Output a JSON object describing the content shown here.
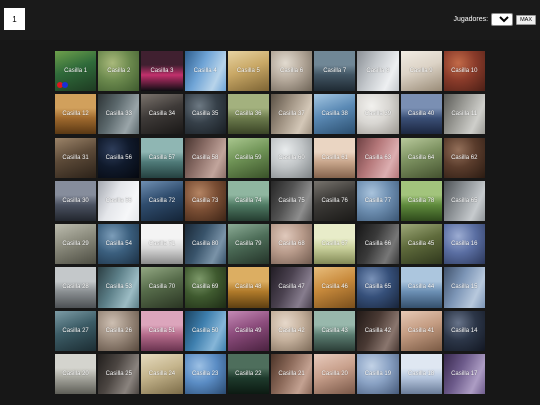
{
  "turn": "1",
  "players": {
    "label": "Jugadores:",
    "selected": "2",
    "max_label": "MAX"
  },
  "tokens": {
    "p1_color": "#e0161c",
    "p2_color": "#1a2fd6"
  },
  "board": {
    "cells": [
      {
        "label": "Casilla 1",
        "colors": [
          "#2f6a3a",
          "#6ea04c",
          "#1e3b22"
        ]
      },
      {
        "label": "Casilla 2",
        "colors": [
          "#6c8a4e",
          "#a9b97b",
          "#3e5a2e"
        ]
      },
      {
        "label": "Casilla 3",
        "colors": [
          "#c1306c",
          "#402030",
          "#0d0d12"
        ]
      },
      {
        "label": "Casilla 4",
        "colors": [
          "#6fa4d6",
          "#b8d4ea",
          "#2f5e8e"
        ]
      },
      {
        "label": "Casilla 5",
        "colors": [
          "#c9a866",
          "#e7d3a2",
          "#7d6434"
        ]
      },
      {
        "label": "Casilla 6",
        "colors": [
          "#b4a89a",
          "#e2dbd0",
          "#6e6457"
        ]
      },
      {
        "label": "Casilla 7",
        "colors": [
          "#415462",
          "#708796",
          "#1f2a33"
        ]
      },
      {
        "label": "Casilla 8",
        "colors": [
          "#c4c8cc",
          "#eef0f2",
          "#8b9096"
        ]
      },
      {
        "label": "Casilla 9",
        "colors": [
          "#dcd3c6",
          "#f1ece3",
          "#9a8c78"
        ]
      },
      {
        "label": "Casilla 10",
        "colors": [
          "#8a3b2a",
          "#c26a48",
          "#4b1f16"
        ]
      },
      {
        "label": "Casilla 12",
        "colors": [
          "#a06a2e",
          "#d1a05c",
          "#5a3814"
        ]
      },
      {
        "label": "Casilla 33",
        "colors": [
          "#5d6a6e",
          "#9aa5a9",
          "#2e3537"
        ]
      },
      {
        "label": "Casilla 34",
        "colors": [
          "#3e3a38",
          "#7b736c",
          "#1a1817"
        ]
      },
      {
        "label": "Casilla 35",
        "colors": [
          "#364049",
          "#6d7983",
          "#181d22"
        ]
      },
      {
        "label": "Casilla 36",
        "colors": [
          "#6b7a4c",
          "#a3b17e",
          "#3a4426"
        ]
      },
      {
        "label": "Casilla 37",
        "colors": [
          "#a09383",
          "#d4c8b8",
          "#5c5246"
        ]
      },
      {
        "label": "Casilla 38",
        "colors": [
          "#5b8ab5",
          "#a5c7e2",
          "#2b4f70"
        ]
      },
      {
        "label": "Casilla 39",
        "colors": [
          "#d8d6d2",
          "#f2f1ee",
          "#9c9892"
        ]
      },
      {
        "label": "Casilla 40",
        "colors": [
          "#3a4f76",
          "#7a8fb3",
          "#1c2640"
        ]
      },
      {
        "label": "Casilla 11",
        "colors": [
          "#9b9b96",
          "#cfcfcb",
          "#5b5b57"
        ]
      },
      {
        "label": "Casilla 31",
        "colors": [
          "#5c4a38",
          "#9c8469",
          "#2c2219"
        ]
      },
      {
        "label": "Casilla 56",
        "colors": [
          "#101a2c",
          "#2e3d5a",
          "#05080f"
        ]
      },
      {
        "label": "Casilla 57",
        "colors": [
          "#4f7a78",
          "#8fb6b3",
          "#254140"
        ]
      },
      {
        "label": "Casilla 58",
        "colors": [
          "#8c6f68",
          "#c2a59c",
          "#4a3631"
        ]
      },
      {
        "label": "Casilla 59",
        "colors": [
          "#6f9356",
          "#a9c68e",
          "#3a5229"
        ]
      },
      {
        "label": "Casilla 60",
        "colors": [
          "#c0c4c6",
          "#e9eced",
          "#7d8285"
        ]
      },
      {
        "label": "Casilla 61",
        "colors": [
          "#c8a68c",
          "#ead5c2",
          "#85644d"
        ]
      },
      {
        "label": "Casilla 63",
        "colors": [
          "#b5787a",
          "#dcaeb0",
          "#6f4244"
        ]
      },
      {
        "label": "Casilla 64",
        "colors": [
          "#7c9160",
          "#b9c99c",
          "#44522f"
        ]
      },
      {
        "label": "Casilla 62",
        "colors": [
          "#5a3c2c",
          "#94705a",
          "#2b1b12"
        ]
      },
      {
        "label": "Casilla 30",
        "colors": [
          "#4a5160",
          "#868d9c",
          "#22262e"
        ]
      },
      {
        "label": "Casilla 55",
        "colors": [
          "#e4e6ea",
          "#f6f7f9",
          "#a4a8b0"
        ]
      },
      {
        "label": "Casilla 72",
        "colors": [
          "#2f4c6d",
          "#6f8fb2",
          "#142437"
        ]
      },
      {
        "label": "Casilla 73",
        "colors": [
          "#7a4e34",
          "#b48463",
          "#3d2416"
        ]
      },
      {
        "label": "Casilla 74",
        "colors": [
          "#4f7a63",
          "#8fb6a0",
          "#243c30"
        ]
      },
      {
        "label": "Casilla 75",
        "colors": [
          "#525252",
          "#8e8e8e",
          "#262626"
        ]
      },
      {
        "label": "Casilla 76",
        "colors": [
          "#3c3a37",
          "#77736d",
          "#1b1a18"
        ]
      },
      {
        "label": "Casilla 77",
        "colors": [
          "#6e8fb1",
          "#a9c3dc",
          "#3a5573"
        ]
      },
      {
        "label": "Casilla 78",
        "colors": [
          "#5e8a3c",
          "#a2c47c",
          "#2f4a1c"
        ]
      },
      {
        "label": "Casilla 65",
        "colors": [
          "#8f9498",
          "#c7cbce",
          "#4e5256"
        ]
      },
      {
        "label": "Casilla 29",
        "colors": [
          "#8a8a7c",
          "#bdbdaf",
          "#4d4d42"
        ]
      },
      {
        "label": "Casilla 54",
        "colors": [
          "#3b5f7e",
          "#7c9db9",
          "#1c3044"
        ]
      },
      {
        "label": "Casilla 71",
        "colors": [
          "#d8d8d8",
          "#f4f4f4",
          "#8c8c8c"
        ]
      },
      {
        "label": "Casilla 80",
        "colors": [
          "#39546b",
          "#7a93a8",
          "#1a2938"
        ]
      },
      {
        "label": "Casilla 79",
        "colors": [
          "#4d6d58",
          "#8cac96",
          "#243429"
        ]
      },
      {
        "label": "Casilla 68",
        "colors": [
          "#b79a8a",
          "#e0c9bc",
          "#715b4f"
        ]
      },
      {
        "label": "Casilla 67",
        "colors": [
          "#c8cf9a",
          "#e8ecc9",
          "#838a57"
        ]
      },
      {
        "label": "Casilla 66",
        "colors": [
          "#3a3a3a",
          "#777777",
          "#171717"
        ]
      },
      {
        "label": "Casilla 45",
        "colors": [
          "#5f6b3c",
          "#9ea979",
          "#30381d"
        ]
      },
      {
        "label": "Casilla 16",
        "colors": [
          "#5a6ea2",
          "#9cacd2",
          "#2b375a"
        ]
      },
      {
        "label": "Casilla 28",
        "colors": [
          "#8a8f92",
          "#c4c8ca",
          "#4d5154"
        ]
      },
      {
        "label": "Casilla 53",
        "colors": [
          "#5c7f88",
          "#9cbcc4",
          "#2c3f44"
        ]
      },
      {
        "label": "Casilla 70",
        "colors": [
          "#566b4a",
          "#93a883",
          "#2a3523"
        ]
      },
      {
        "label": "Casilla 69",
        "colors": [
          "#3f5a2f",
          "#7d996a",
          "#1d2b15"
        ]
      },
      {
        "label": "Casilla 48",
        "colors": [
          "#b07a2a",
          "#dcae62",
          "#5e3f12"
        ]
      },
      {
        "label": "Casilla 47",
        "colors": [
          "#4b4250",
          "#877d8e",
          "#221d25"
        ]
      },
      {
        "label": "Casilla 46",
        "colors": [
          "#c88a3c",
          "#e8bd7c",
          "#7a4f1c"
        ]
      },
      {
        "label": "Casilla 65",
        "colors": [
          "#36507a",
          "#7a92b8",
          "#18243a"
        ]
      },
      {
        "label": "Casilla 44",
        "colors": [
          "#6b8fb4",
          "#acc6de",
          "#35506d"
        ]
      },
      {
        "label": "Casilla 15",
        "colors": [
          "#7c95b6",
          "#b8c9dd",
          "#41536d"
        ]
      },
      {
        "label": "Casilla 27",
        "colors": [
          "#3c5c66",
          "#7c9ca6",
          "#1c2d33"
        ]
      },
      {
        "label": "Casilla 26",
        "colors": [
          "#9a8a7c",
          "#cdbfb2",
          "#58493d"
        ]
      },
      {
        "label": "Casilla 51",
        "colors": [
          "#b46a8a",
          "#dca5bc",
          "#6a3450"
        ]
      },
      {
        "label": "Casilla 50",
        "colors": [
          "#3e7fae",
          "#86b6d8",
          "#1b4462"
        ]
      },
      {
        "label": "Casilla 49",
        "colors": [
          "#8c4c7c",
          "#c48ab6",
          "#4a2240"
        ]
      },
      {
        "label": "Casilla 42",
        "colors": [
          "#c4b09c",
          "#e6d8ca",
          "#7c6a58"
        ]
      },
      {
        "label": "Casilla 43",
        "colors": [
          "#5a7c70",
          "#98b8ac",
          "#2c3e37"
        ]
      },
      {
        "label": "Casilla 42",
        "colors": [
          "#4a3a34",
          "#8a766e",
          "#221a17"
        ]
      },
      {
        "label": "Casilla 41",
        "colors": [
          "#c49c82",
          "#e6c9b6",
          "#7a5a44"
        ]
      },
      {
        "label": "Casilla 14",
        "colors": [
          "#2c3648",
          "#677389",
          "#121722"
        ]
      },
      {
        "label": "Casilla 20",
        "colors": [
          "#a4a49c",
          "#d4d4ce",
          "#5e5e57"
        ]
      },
      {
        "label": "Casilla 25",
        "colors": [
          "#4c4642",
          "#8a837e",
          "#221f1d"
        ]
      },
      {
        "label": "Casilla 24",
        "colors": [
          "#c4b48c",
          "#e6dbbf",
          "#7c6c48"
        ]
      },
      {
        "label": "Casilla 23",
        "colors": [
          "#5a8cc4",
          "#9cc0e4",
          "#2a4a70"
        ]
      },
      {
        "label": "Casilla 22",
        "colors": [
          "#1e3a2c",
          "#4e6e5c",
          "#0c1a12"
        ]
      },
      {
        "label": "Casilla 21",
        "colors": [
          "#8c6a5a",
          "#c4a292",
          "#4c3428"
        ]
      },
      {
        "label": "Casilla 20",
        "colors": [
          "#c8a08c",
          "#e8cbbd",
          "#7a5848"
        ]
      },
      {
        "label": "Casilla 19",
        "colors": [
          "#8aa2c4",
          "#c2d2e6",
          "#465a7a"
        ]
      },
      {
        "label": "Casilla 18",
        "colors": [
          "#b4c4dc",
          "#dfe7f2",
          "#6a7c98"
        ]
      },
      {
        "label": "Casilla 17",
        "colors": [
          "#6e5c8c",
          "#ad9dc4",
          "#38284e"
        ]
      }
    ]
  }
}
